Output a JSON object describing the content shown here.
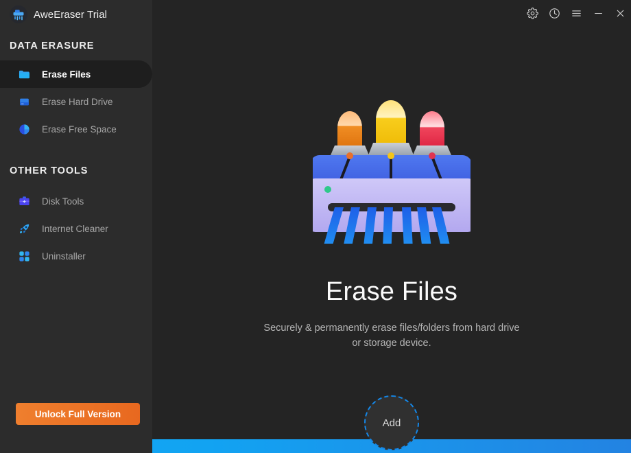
{
  "window": {
    "app_title": "AweEraser Trial",
    "app_icon": "shredder-icon",
    "controls": [
      {
        "name": "settings",
        "icon": "gear-icon"
      },
      {
        "name": "history",
        "icon": "clock-icon"
      },
      {
        "name": "menu",
        "icon": "hamburger-icon"
      },
      {
        "name": "minimize",
        "icon": "minimize-icon"
      },
      {
        "name": "close",
        "icon": "close-icon"
      }
    ]
  },
  "sidebar": {
    "sections": [
      {
        "title": "DATA ERASURE"
      },
      {
        "title": "OTHER TOOLS"
      }
    ],
    "data_erasure_items": [
      {
        "label": "Erase Files",
        "icon": "folder-icon",
        "active": true
      },
      {
        "label": "Erase Hard Drive",
        "icon": "hard-drive-icon",
        "active": false
      },
      {
        "label": "Erase Free Space",
        "icon": "pie-chart-icon",
        "active": false
      }
    ],
    "other_tools_items": [
      {
        "label": "Disk Tools",
        "icon": "toolbox-icon",
        "active": false
      },
      {
        "label": "Internet Cleaner",
        "icon": "rocket-icon",
        "active": false
      },
      {
        "label": "Uninstaller",
        "icon": "grid-squares-icon",
        "active": false
      }
    ],
    "unlock_button_label": "Unlock Full Version"
  },
  "main": {
    "illustration": "paper-shredder-illustration",
    "title": "Erase Files",
    "description_line1": "Securely & permanently erase files/folders from hard drive",
    "description_line2": "or storage device.",
    "add_button_label": "Add"
  },
  "colors": {
    "background": "#242424",
    "sidebar": "#2c2c2c",
    "active_item": "#1e1e1e",
    "accent_blue": "#1487e8",
    "unlock_orange": "#e8681f",
    "title_text": "#fafafa",
    "muted_text": "#a6a6a6",
    "bottom_strip_start": "#11a7f5",
    "bottom_strip_end": "#2383e2"
  }
}
